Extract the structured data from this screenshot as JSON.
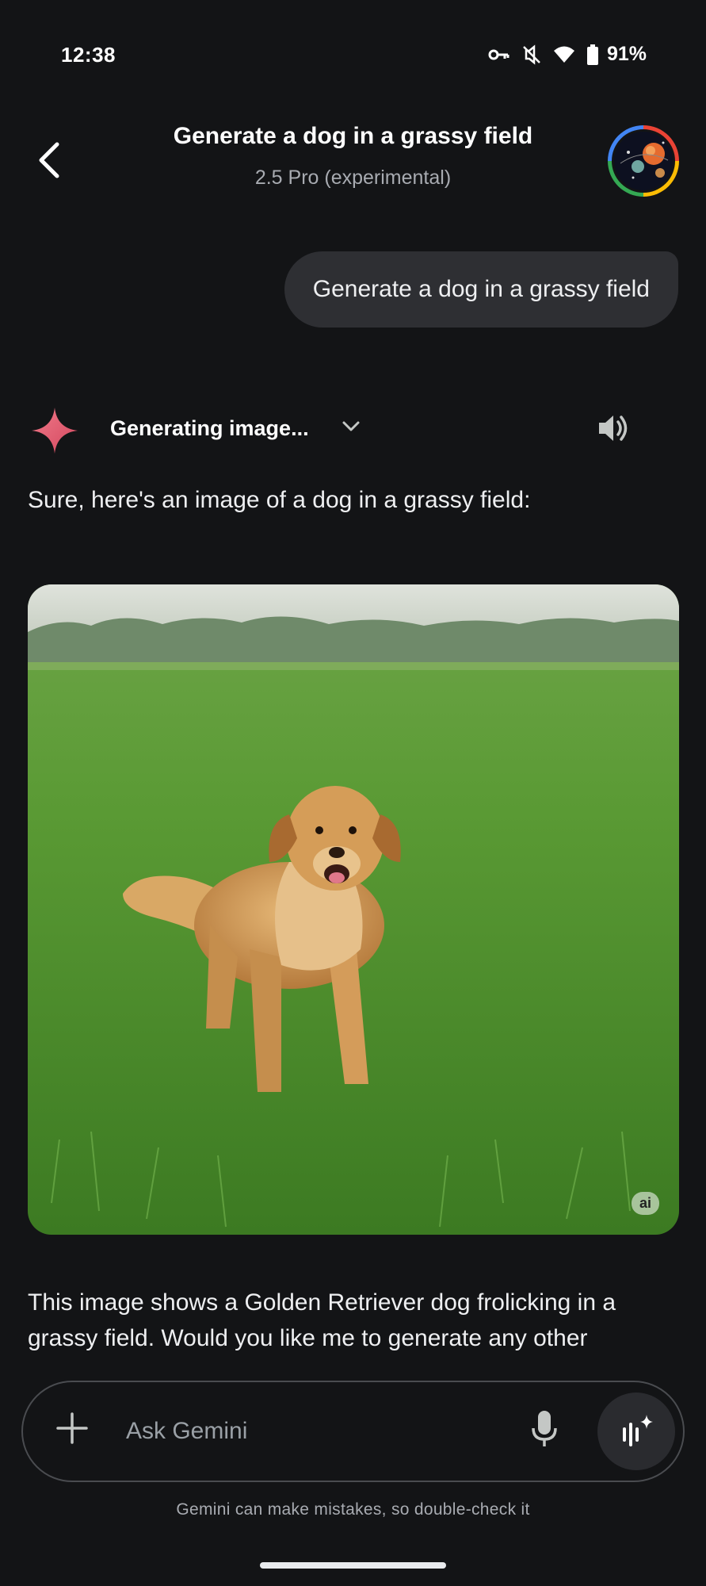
{
  "status_bar": {
    "time": "12:38",
    "battery": "91%",
    "icons": [
      "vpn-key-icon",
      "mute-icon",
      "wifi-icon",
      "battery-icon"
    ]
  },
  "header": {
    "title": "Generate a dog in a grassy field",
    "subtitle": "2.5 Pro (experimental)"
  },
  "conversation": {
    "user_message": "Generate a dog in a grassy field",
    "response": {
      "status_label": "Generating image...",
      "intro": "Sure, here's an image of a dog in a grassy field:",
      "image_badge": "ai",
      "body": "This image shows a Golden Retriever dog frolicking in a grassy field. Would you like me to generate any other"
    }
  },
  "input": {
    "placeholder": "Ask Gemini"
  },
  "disclaimer": "Gemini can make mistakes, so double-check it",
  "colors": {
    "background": "#131416",
    "bubble": "#2e2f33",
    "spark_pink": "#e8667a",
    "secondary_text": "#a8abb1"
  }
}
